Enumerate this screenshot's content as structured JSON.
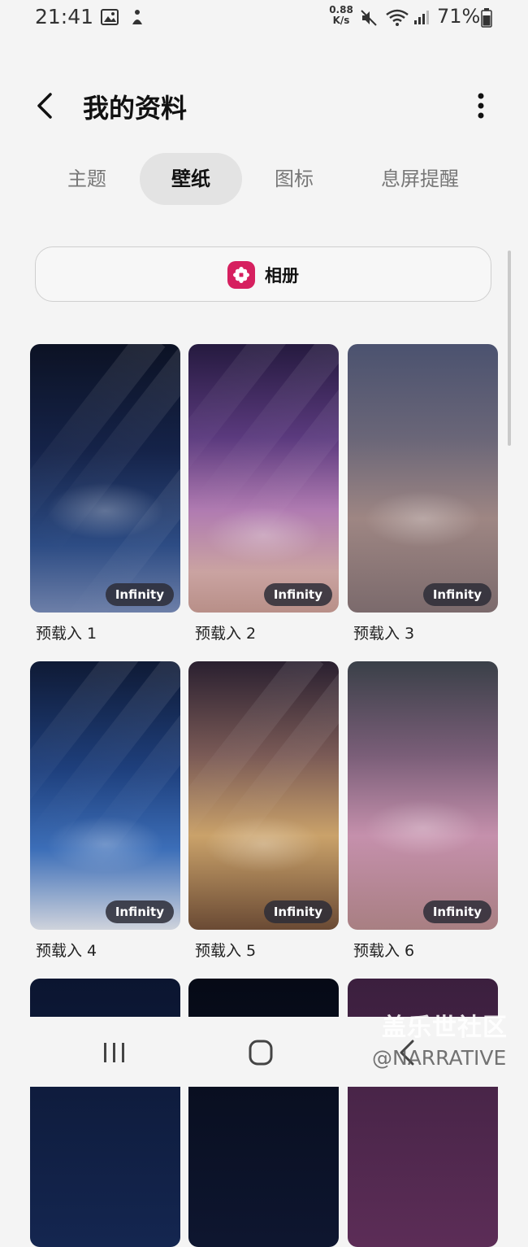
{
  "status_bar": {
    "time": "21:41",
    "net_speed_value": "0.88",
    "net_speed_unit": "K/s",
    "battery_text": "71%"
  },
  "header": {
    "title": "我的资料"
  },
  "tabs": [
    {
      "label": "主题",
      "active": false
    },
    {
      "label": "壁纸",
      "active": true
    },
    {
      "label": "图标",
      "active": false
    },
    {
      "label": "息屏提醒",
      "active": false
    }
  ],
  "album_button": {
    "label": "相册",
    "icon": "flower-icon",
    "icon_color": "#d6205f"
  },
  "wallpapers": [
    {
      "caption": "预载入 1",
      "badge": "Infinity"
    },
    {
      "caption": "预载入 2",
      "badge": "Infinity"
    },
    {
      "caption": "预载入 3",
      "badge": "Infinity"
    },
    {
      "caption": "预载入 4",
      "badge": "Infinity"
    },
    {
      "caption": "预载入 5",
      "badge": "Infinity"
    },
    {
      "caption": "预载入 6",
      "badge": "Infinity"
    }
  ],
  "watermark": {
    "line1": "盖乐世社区",
    "line2": "@NARRATIVE"
  }
}
